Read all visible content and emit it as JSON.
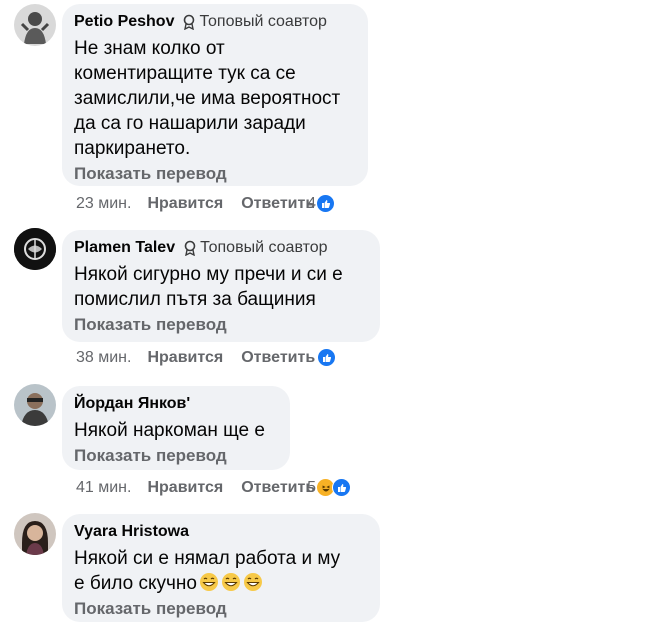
{
  "comments": [
    {
      "name": "Petio Peshov",
      "badge": "Топовый соавтор",
      "text": "Не знам колко от\nкоментиращите тук са се\nзамислили,че има вероятност\nда са го нашарили заради\nпаркирането.",
      "translate": "Показать перевод",
      "time": "23 мин.",
      "like": "Нравится",
      "reply": "Ответить",
      "reaction_count": "4",
      "reactions": [
        "like-icon"
      ]
    },
    {
      "name": "Plamen Talev",
      "badge": "Топовый соавтор",
      "text": "Някой сигурно му пречи и си е\nпомислил пътя за бащиния",
      "translate": "Показать перевод",
      "time": "38 мин.",
      "like": "Нравится",
      "reply": "Ответить",
      "reaction_count": "",
      "reactions": [
        "like-icon"
      ]
    },
    {
      "name": "Йордан Янков'",
      "badge": "",
      "text": "Някой наркоман ще е",
      "translate": "Показать перевод",
      "time": "41 мин.",
      "like": "Нравится",
      "reply": "Ответить",
      "reaction_count": "5",
      "reactions": [
        "haha-icon",
        "like-icon"
      ]
    },
    {
      "name": "Vyara Hristowa",
      "badge": "",
      "text": "Някой си е нямал работа  и му\nе било скучно",
      "text_emojis": [
        "grinning-face-icon",
        "grinning-face-icon",
        "grinning-face-icon"
      ],
      "translate": "Показать перевод"
    }
  ],
  "colors": {
    "bubble": "#f0f2f5",
    "meta": "#65676b",
    "like": "#1877f2",
    "haha": "#f7b125"
  }
}
